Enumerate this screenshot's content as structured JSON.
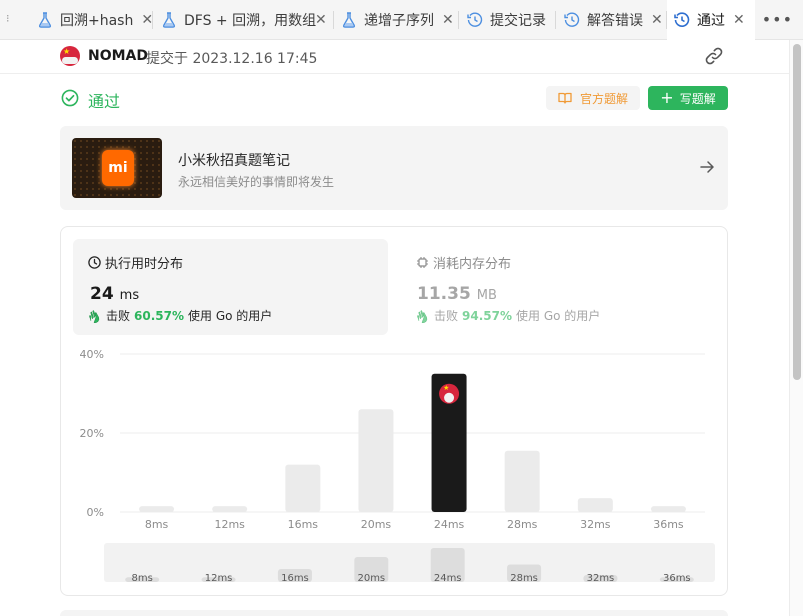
{
  "tabs": [
    {
      "label": "回溯+hash",
      "icon": "flask-icon"
    },
    {
      "label": "DFS + 回溯，用数组",
      "icon": "flask-icon"
    },
    {
      "label": "递增子序列",
      "icon": "flask-icon"
    },
    {
      "label": "提交记录",
      "icon": "history-icon"
    },
    {
      "label": "解答错误",
      "icon": "history-icon"
    },
    {
      "label": "通过",
      "icon": "history-icon",
      "active": true
    }
  ],
  "submission": {
    "user": "NOMAD",
    "submitted_at": "提交于 2023.12.16 17:45",
    "status": "通过"
  },
  "actions": {
    "official_solution": "官方题解",
    "write_solution": "写题解"
  },
  "promo": {
    "logo_text": "mi",
    "title": "小米秋招真题笔记",
    "subtitle": "永远相信美好的事情即将发生"
  },
  "runtime": {
    "title": "执行用时分布",
    "value": "24",
    "unit": "ms",
    "beat_prefix": "击败",
    "beat_pct": "60.57%",
    "beat_suffix": "使用 Go 的用户"
  },
  "memory": {
    "title": "消耗内存分布",
    "value": "11.35",
    "unit": "MB",
    "beat_prefix": "击败",
    "beat_pct": "94.57%",
    "beat_suffix": "使用 Go 的用户"
  },
  "colors": {
    "accent_green": "#2db55d",
    "official_orange": "#f09a36",
    "bar_gray": "#ebebeb",
    "bar_active": "#1a1a1a"
  },
  "chart_data": {
    "type": "bar",
    "categories": [
      "8ms",
      "12ms",
      "16ms",
      "20ms",
      "24ms",
      "28ms",
      "32ms",
      "36ms"
    ],
    "values": [
      1.5,
      1.5,
      12,
      26,
      35,
      15.5,
      3.5,
      1.5
    ],
    "highlight": "24ms",
    "y_ticks": [
      "40%",
      "20%",
      "0%"
    ],
    "ylim": [
      0,
      40
    ],
    "grid": true,
    "minimap_values": [
      0.5,
      0.5,
      6,
      14,
      20,
      9,
      2,
      0.5
    ]
  }
}
